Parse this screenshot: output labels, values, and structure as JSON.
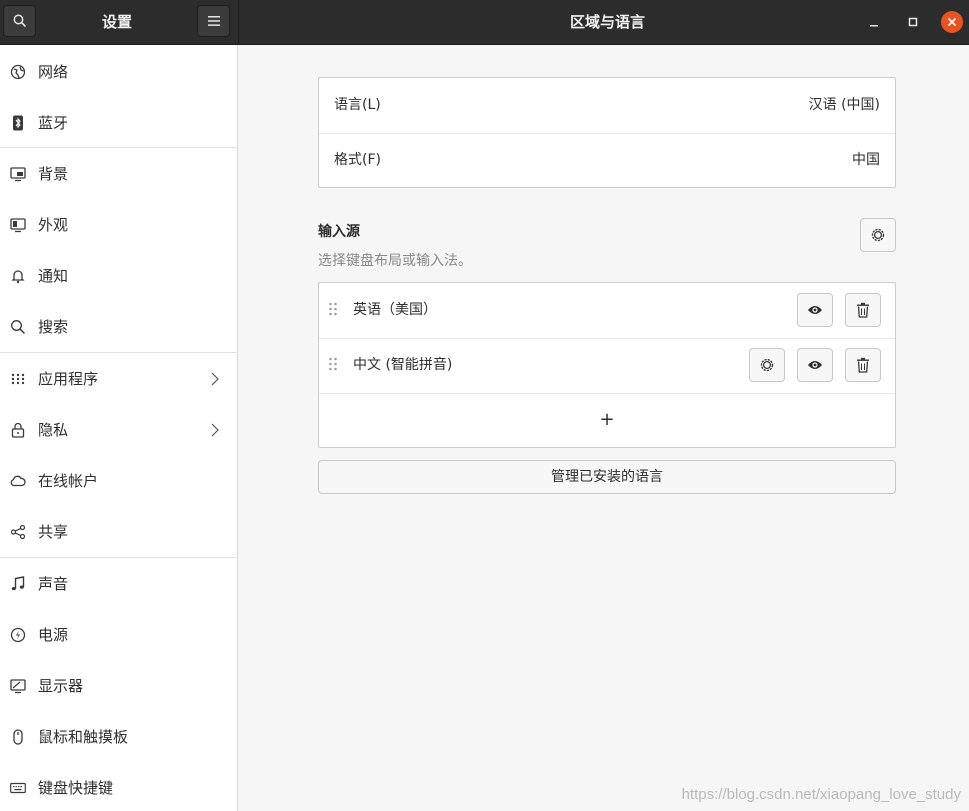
{
  "header": {
    "sidebar_title": "设置",
    "page_title": "区域与语言"
  },
  "sidebar": {
    "items": [
      {
        "label": "网络",
        "icon": "network-icon"
      },
      {
        "label": "蓝牙",
        "icon": "bluetooth-icon"
      },
      {
        "label": "背景",
        "icon": "background-icon"
      },
      {
        "label": "外观",
        "icon": "appearance-icon"
      },
      {
        "label": "通知",
        "icon": "bell-icon"
      },
      {
        "label": "搜索",
        "icon": "search-icon"
      },
      {
        "label": "应用程序",
        "icon": "apps-grid-icon",
        "has_chevron": true
      },
      {
        "label": "隐私",
        "icon": "lock-icon",
        "has_chevron": true
      },
      {
        "label": "在线帐户",
        "icon": "cloud-icon"
      },
      {
        "label": "共享",
        "icon": "share-icon"
      },
      {
        "label": "声音",
        "icon": "music-note-icon"
      },
      {
        "label": "电源",
        "icon": "power-icon"
      },
      {
        "label": "显示器",
        "icon": "display-icon"
      },
      {
        "label": "鼠标和触摸板",
        "icon": "mouse-icon"
      },
      {
        "label": "键盘快捷键",
        "icon": "keyboard-icon"
      }
    ]
  },
  "main": {
    "language": {
      "label": "语言(L)",
      "value": "汉语 (中国)"
    },
    "formats": {
      "label": "格式(F)",
      "value": "中国"
    },
    "input_sources": {
      "title": "输入源",
      "subtitle": "选择键盘布局或输入法。",
      "items": [
        {
          "label": "英语（美国）",
          "has_settings": false
        },
        {
          "label": "中文 (智能拼音)",
          "has_settings": true
        }
      ],
      "add_label": "+"
    },
    "manage_button": "管理已安装的语言"
  },
  "watermark": "https://blog.csdn.net/xiaopang_love_study",
  "colors": {
    "header_bg": "#2c2c2c",
    "close_button": "#e95420",
    "sidebar_bg": "#ffffff",
    "content_bg": "#f6f6f6"
  }
}
